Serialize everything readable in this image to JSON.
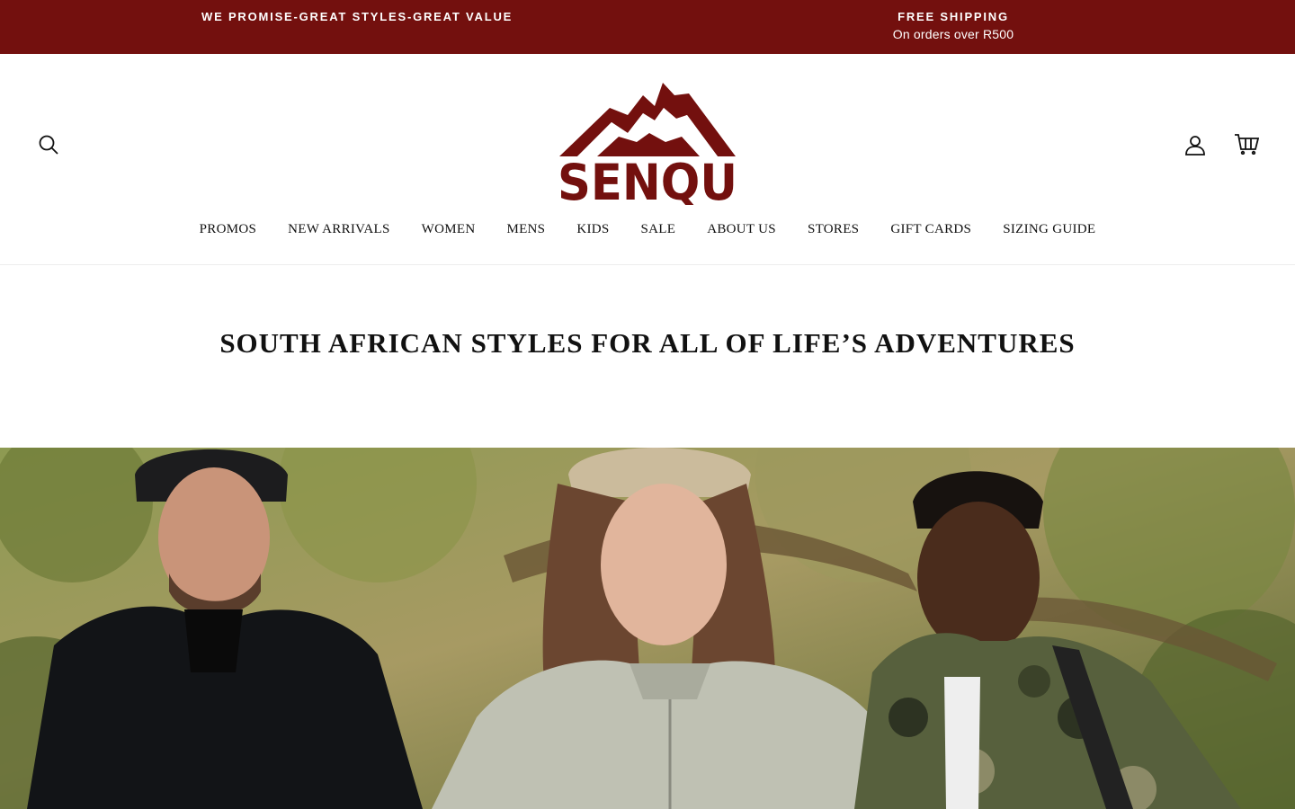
{
  "announcement": {
    "left_text": "WE PROMISE-GREAT STYLES-GREAT VALUE",
    "shipping_title": "FREE SHIPPING",
    "shipping_subtitle": "On orders over R500"
  },
  "header": {
    "logo_text": "SENQU",
    "icons": {
      "search": "search-icon",
      "account": "account-icon",
      "cart": "cart-icon"
    }
  },
  "nav": {
    "items": [
      "PROMOS",
      "NEW ARRIVALS",
      "WOMEN",
      "MENS",
      "KIDS",
      "SALE",
      "ABOUT US",
      "STORES",
      "GIFT CARDS",
      "SIZING GUIDE"
    ]
  },
  "main": {
    "headline": "SOUTH AFRICAN STYLES FOR ALL OF LIFE’S ADVENTURES"
  },
  "colors": {
    "brand": "#73100e",
    "text": "#111111",
    "background": "#ffffff"
  }
}
